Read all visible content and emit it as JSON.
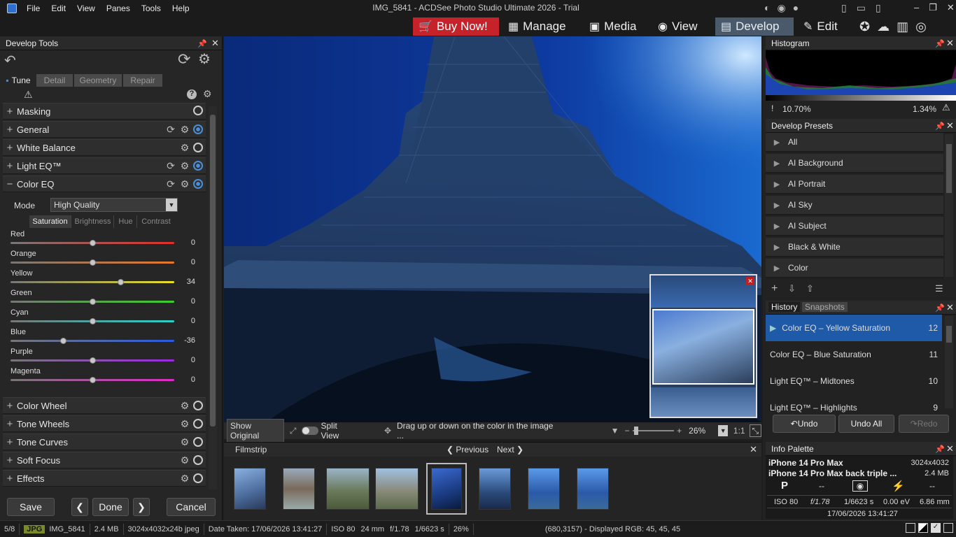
{
  "window": {
    "title": "IMG_5841 - ACDSee Photo Studio Ultimate 2026 - Trial"
  },
  "menu": [
    "File",
    "Edit",
    "View",
    "Panes",
    "Tools",
    "Help"
  ],
  "modes": {
    "buy": "Buy Now!",
    "manage": "Manage",
    "media": "Media",
    "view": "View",
    "develop": "Develop",
    "edit": "Edit"
  },
  "develop_tools": {
    "title": "Develop Tools",
    "tabs": [
      "Tune",
      "Detail",
      "Geometry",
      "Repair"
    ],
    "sections_top": [
      "Masking",
      "General",
      "White Balance",
      "Light EQ™",
      "Color EQ"
    ],
    "sections_bottom": [
      "Color Wheel",
      "Tone Wheels",
      "Tone Curves",
      "Soft Focus",
      "Effects"
    ],
    "color_eq": {
      "mode_label": "Mode",
      "mode_value": "High Quality",
      "subtabs": [
        "Saturation",
        "Brightness",
        "Hue",
        "Contrast"
      ],
      "sliders": [
        {
          "label": "Red",
          "value": "0",
          "level": 0,
          "color": "#e0302a"
        },
        {
          "label": "Orange",
          "value": "0",
          "level": 0,
          "color": "#e8782a"
        },
        {
          "label": "Yellow",
          "value": "34",
          "level": 34,
          "color": "#e8e02a"
        },
        {
          "label": "Green",
          "value": "0",
          "level": 0,
          "color": "#3ad02a"
        },
        {
          "label": "Cyan",
          "value": "0",
          "level": 0,
          "color": "#2ad0c8"
        },
        {
          "label": "Blue",
          "value": "-36",
          "level": -36,
          "color": "#2a5ae0"
        },
        {
          "label": "Purple",
          "value": "0",
          "level": 0,
          "color": "#9a2ae0"
        },
        {
          "label": "Magenta",
          "value": "0",
          "level": 0,
          "color": "#e02ac8"
        }
      ]
    },
    "buttons": {
      "save": "Save",
      "done": "Done",
      "cancel": "Cancel"
    }
  },
  "view_toolbar": {
    "show_original": "Show Original",
    "split_view": "Split View",
    "hint": "Drag up or down on the color in the image ...",
    "zoom": "26%",
    "one_to_one": "1:1"
  },
  "filmstrip": {
    "title": "Filmstrip",
    "previous": "Previous",
    "next": "Next",
    "selected_index": 4
  },
  "histogram": {
    "title": "Histogram",
    "left_pct": "10.70%",
    "right_pct": "1.34%"
  },
  "presets": {
    "title": "Develop Presets",
    "items": [
      "All",
      "AI Background",
      "AI Portrait",
      "AI Sky",
      "AI Subject",
      "Black & White",
      "Color"
    ]
  },
  "history": {
    "tabs": [
      "History",
      "Snapshots"
    ],
    "items": [
      {
        "label": "Color EQ – Yellow Saturation",
        "num": "12"
      },
      {
        "label": "Color EQ – Blue Saturation",
        "num": "11"
      },
      {
        "label": "Light EQ™ – Midtones",
        "num": "10"
      },
      {
        "label": "Light EQ™ – Highlights",
        "num": "9"
      }
    ],
    "undo": "Undo",
    "undo_all": "Undo All",
    "redo": "Redo"
  },
  "info": {
    "title": "Info Palette",
    "camera": "iPhone 14 Pro Max",
    "lens": "iPhone 14 Pro Max back triple ...",
    "dims": "3024x4032",
    "size": "2.4 MB",
    "mode": "P",
    "dash1": "--",
    "dash2": "--",
    "iso": "ISO 80",
    "aperture": "f/1.78",
    "shutter": "1/6623 s",
    "ev": "0.00 eV",
    "focal": "6.86 mm",
    "date": "17/06/2026 13:41:27"
  },
  "status": {
    "count": "5/8",
    "type": "JPG",
    "name": "IMG_5841",
    "size": "2.4 MB",
    "dims": "3024x4032x24b jpeg",
    "date": "Date Taken: 17/06/2026 13:41:27",
    "iso": "ISO 80",
    "focal": "24 mm",
    "aperture": "f/1.78",
    "shutter": "1/6623 s",
    "zoom": "26%",
    "pixel": "(680,3157) - Displayed RGB: 45, 45, 45"
  }
}
